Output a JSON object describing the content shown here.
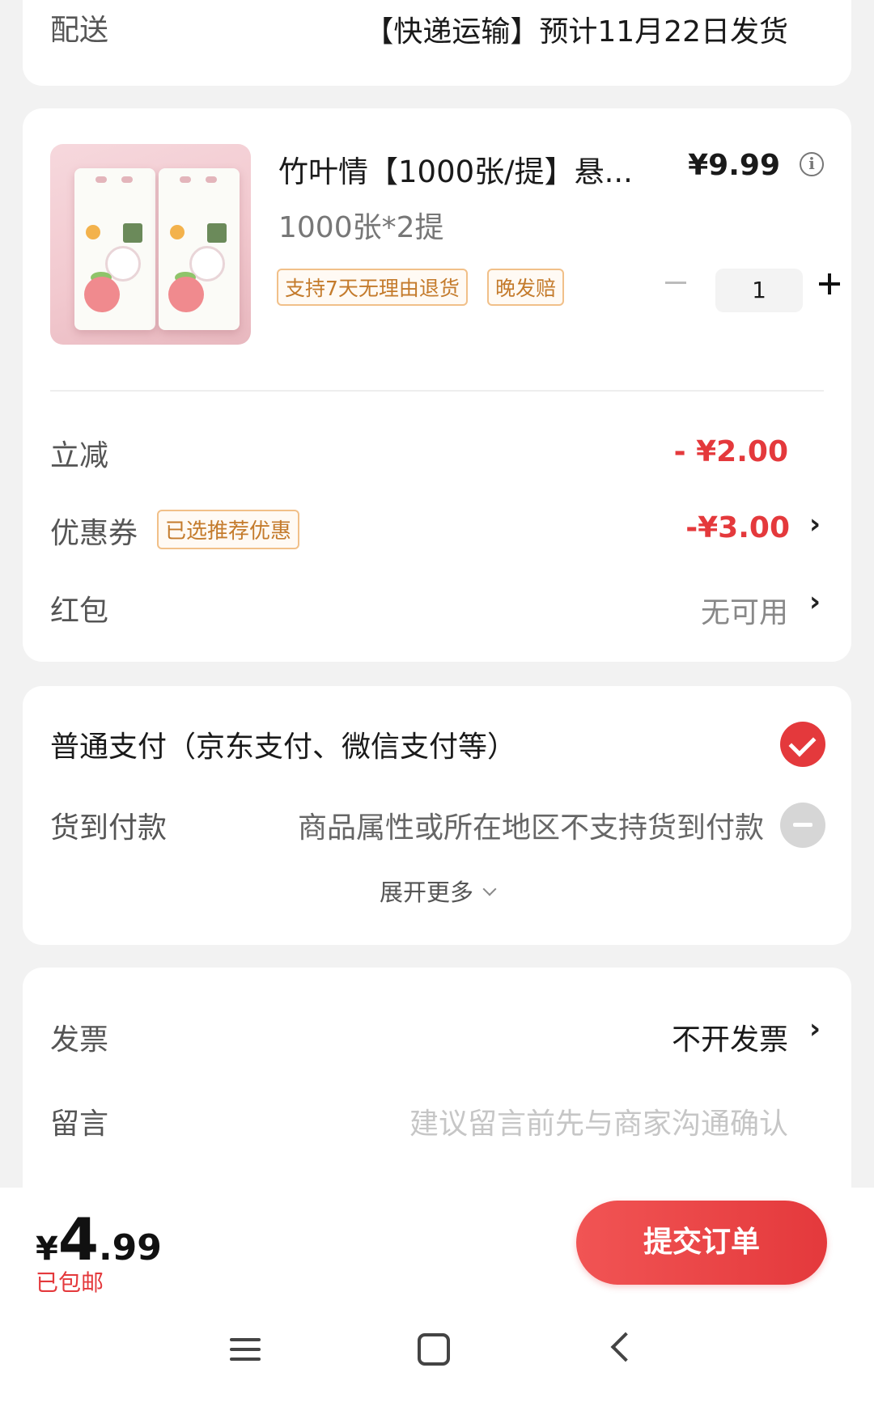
{
  "delivery": {
    "label": "配送",
    "value": "【快递运输】预计11月22日发货"
  },
  "product": {
    "title": "竹叶情【1000张/提】悬...",
    "price": "¥9.99",
    "info_icon": "info-icon",
    "spec": "1000张*2提",
    "tags": [
      "支持7天无理由退货",
      "晚发赔"
    ],
    "quantity": "1",
    "image_colors": {
      "background": "#f2c9cf",
      "pack": "#fbfbf7"
    }
  },
  "discounts": {
    "instant_label": "立减",
    "instant_value": "- ¥2.00",
    "coupon_label": "优惠券",
    "coupon_badge": "已选推荐优惠",
    "coupon_value": "-¥3.00",
    "redpacket_label": "红包",
    "redpacket_value": "无可用",
    "chevron": "›"
  },
  "payment": {
    "normal_label": "普通支付（京东支付、微信支付等）",
    "normal_selected": true,
    "cod_label": "货到付款",
    "cod_note": "商品属性或所在地区不支持货到付款",
    "cod_enabled": false,
    "more_label": "展开更多"
  },
  "invoice": {
    "label": "发票",
    "value": "不开发票",
    "note_label": "留言",
    "note_placeholder": "建议留言前先与商家沟通确认"
  },
  "checkout": {
    "currency": "¥",
    "total_int": "4",
    "total_dec": ".99",
    "shipping_note": "已包邮",
    "submit_label": "提交订单"
  },
  "colors": {
    "accent": "#e4393c",
    "tag_border": "#f1c089",
    "tag_text": "#c47b2c",
    "page_bg": "#f2f2f2"
  },
  "nav": {
    "icons": [
      "menu-icon",
      "home-icon",
      "back-icon"
    ]
  }
}
